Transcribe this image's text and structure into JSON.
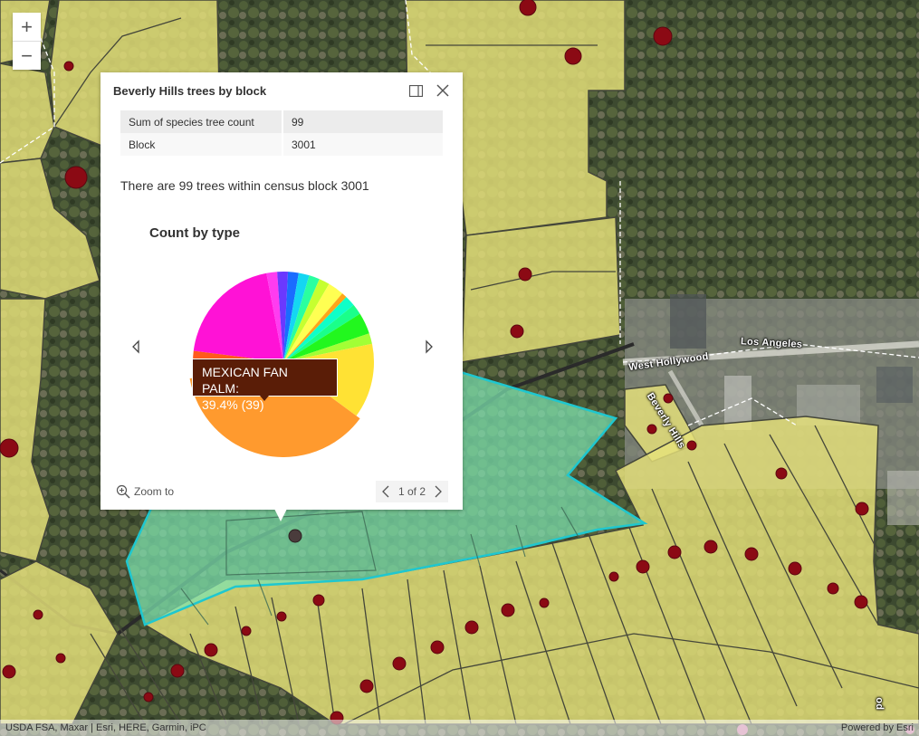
{
  "map": {
    "zoom_in_label": "+",
    "zoom_out_label": "−",
    "labels": {
      "los_angeles": "Los Angeles",
      "west_hollywood": "West Hollywood",
      "beverly_hills": "Beverly Hills",
      "partial_right": "po"
    },
    "attribution": "USDA FSA, Maxar | Esri, HERE, Garmin, iPC",
    "powered_by": "Powered by Esri",
    "colors": {
      "parcel_fill": "#e7e27a",
      "selected_fill": "#7de3b0",
      "selected_outline": "#1fc7cf",
      "tree_point": "#8b0a14"
    }
  },
  "popup": {
    "title": "Beverly Hills trees by block",
    "dock_icon": "dock-icon",
    "close_icon": "close-icon",
    "fields": [
      {
        "label": "Sum of species tree count",
        "value": "99"
      },
      {
        "label": "Block",
        "value": "3001"
      }
    ],
    "description": "There are 99 trees within census block 3001",
    "chart_title": "Count by type",
    "tooltip_line1": "MEXICAN FAN PALM:",
    "tooltip_line2": "39.4% (39)",
    "zoom_to_label": "Zoom to",
    "pager_label": "1 of 2"
  },
  "chart_data": {
    "type": "pie",
    "title": "Count by type",
    "total": 99,
    "slices": [
      {
        "label": "MEXICAN FAN PALM",
        "value": 39,
        "percent": 39.4,
        "color": "#ff9a2e"
      },
      {
        "label": "",
        "value": 2,
        "color": "#ff2c16"
      },
      {
        "label": "",
        "value": 3,
        "color": "#ff5a1c"
      },
      {
        "label": "",
        "value": 21,
        "color": "#ff12d6"
      },
      {
        "label": "",
        "value": 2,
        "color": "#ff3cf0"
      },
      {
        "label": "",
        "value": 2,
        "color": "#6a38ff"
      },
      {
        "label": "",
        "value": 2,
        "color": "#1a6cff"
      },
      {
        "label": "",
        "value": 2,
        "color": "#14d6f2"
      },
      {
        "label": "",
        "value": 2,
        "color": "#2affa0"
      },
      {
        "label": "",
        "value": 2,
        "color": "#c6ff30"
      },
      {
        "label": "",
        "value": 3,
        "color": "#ffff52"
      },
      {
        "label": "",
        "value": 1,
        "color": "#ffa61a"
      },
      {
        "label": "",
        "value": 2,
        "color": "#0fffc8"
      },
      {
        "label": "",
        "value": 2,
        "color": "#1aff8a"
      },
      {
        "label": "",
        "value": 4,
        "color": "#22f71e"
      },
      {
        "label": "",
        "value": 2,
        "color": "#a2ff35"
      },
      {
        "label": "",
        "value": 14,
        "color": "#ffe234"
      }
    ]
  }
}
